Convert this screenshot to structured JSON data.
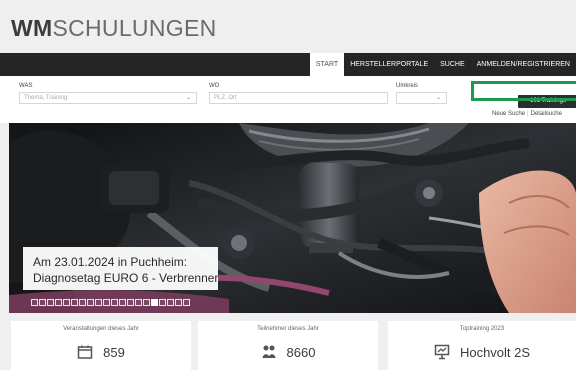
{
  "header": {
    "logo_bold": "WM",
    "logo_light": "SCHULUNGEN"
  },
  "nav": {
    "items": [
      {
        "label": "START",
        "active": true
      },
      {
        "label": "HERSTELLERPORTALE",
        "active": false
      },
      {
        "label": "SUCHE",
        "active": false
      },
      {
        "label": "ANMELDEN/REGISTRIEREN",
        "active": false
      }
    ]
  },
  "search": {
    "was_label": "WAS",
    "was_placeholder": "Thema, Training",
    "wo_label": "WO",
    "wo_placeholder": "PLZ, Ort",
    "umkreis_label": "Umkreis",
    "button_label": "101 Trainings",
    "link_new": "Neue Suche",
    "link_detail": "Detailsuche"
  },
  "hero": {
    "caption_line1": "Am 23.01.2024 in Puchheim:",
    "caption_line2": "Diagnosetag EURO 6 - Verbrenner",
    "slides_total": 20,
    "slide_active": 16
  },
  "stats": [
    {
      "title": "Veranstaltungen dieses Jahr",
      "value": "859",
      "icon": "calendar-icon"
    },
    {
      "title": "Teilnehmer dieses Jahr",
      "value": "8660",
      "icon": "people-icon"
    },
    {
      "title": "Toptraining 2023",
      "value": "Hochvolt 2S",
      "icon": "presentation-icon"
    }
  ],
  "colors": {
    "nav_bg": "#252525",
    "highlight": "#1b9a55",
    "page_bg": "#efefef"
  }
}
